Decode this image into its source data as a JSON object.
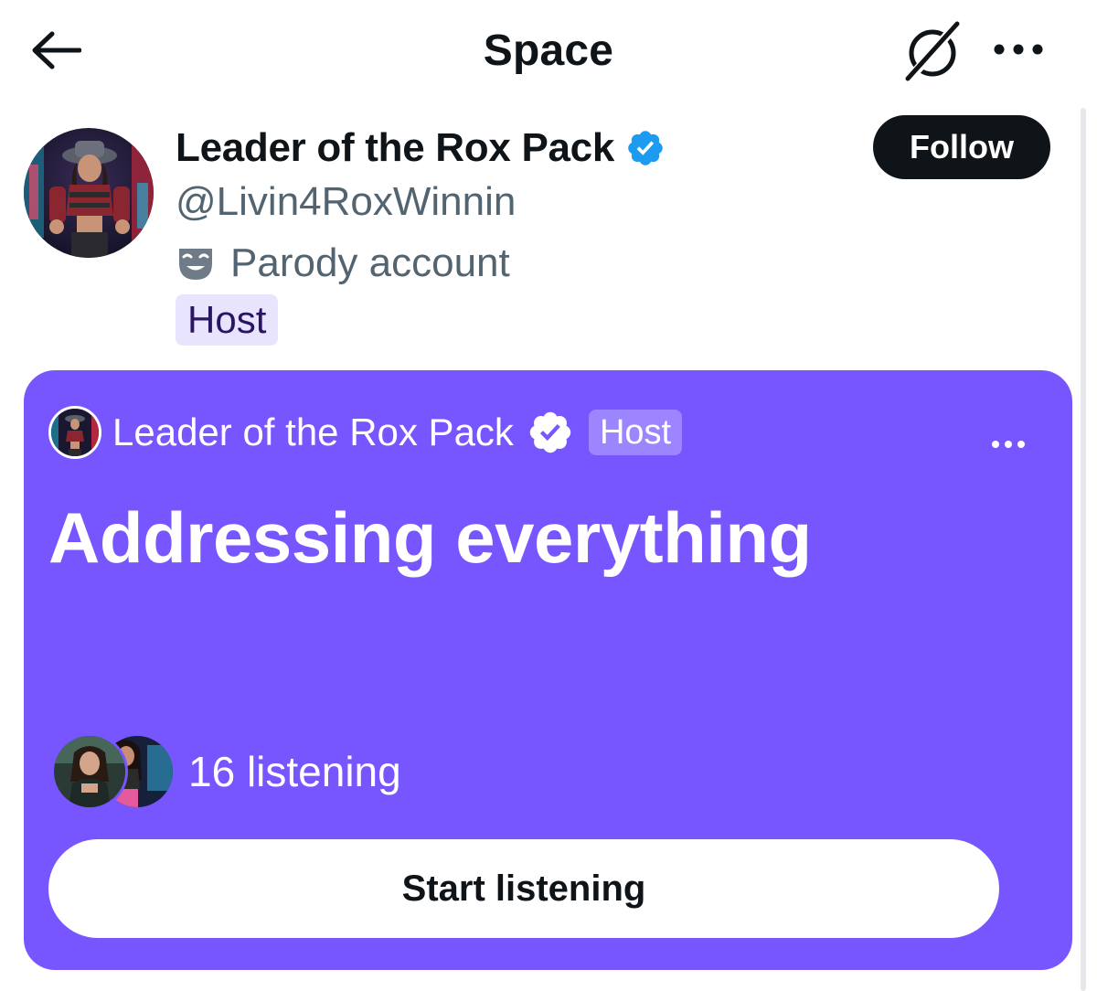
{
  "header": {
    "title": "Space",
    "back_icon": "arrow-left-icon",
    "mute_icon": "microphone-off-icon",
    "more_icon": "more-horizontal-icon"
  },
  "profile": {
    "display_name": "Leader of the Rox Pack",
    "handle": "@Livin4RoxWinnin",
    "label": "Parody account",
    "label_icon": "theater-mask-icon",
    "role_tag": "Host",
    "follow_label": "Follow",
    "verified": true
  },
  "space": {
    "host_name": "Leader of the Rox Pack",
    "host_tag": "Host",
    "title": "Addressing everything",
    "listening": "16 listening",
    "start_label": "Start listening",
    "more_icon": "more-horizontal-icon"
  },
  "colors": {
    "space_bg": "#7856ff",
    "verified_blue": "#1d9bf0",
    "host_tag_bg": "#e9e4fd",
    "follow_bg": "#0f1419",
    "secondary_text": "#536471"
  }
}
